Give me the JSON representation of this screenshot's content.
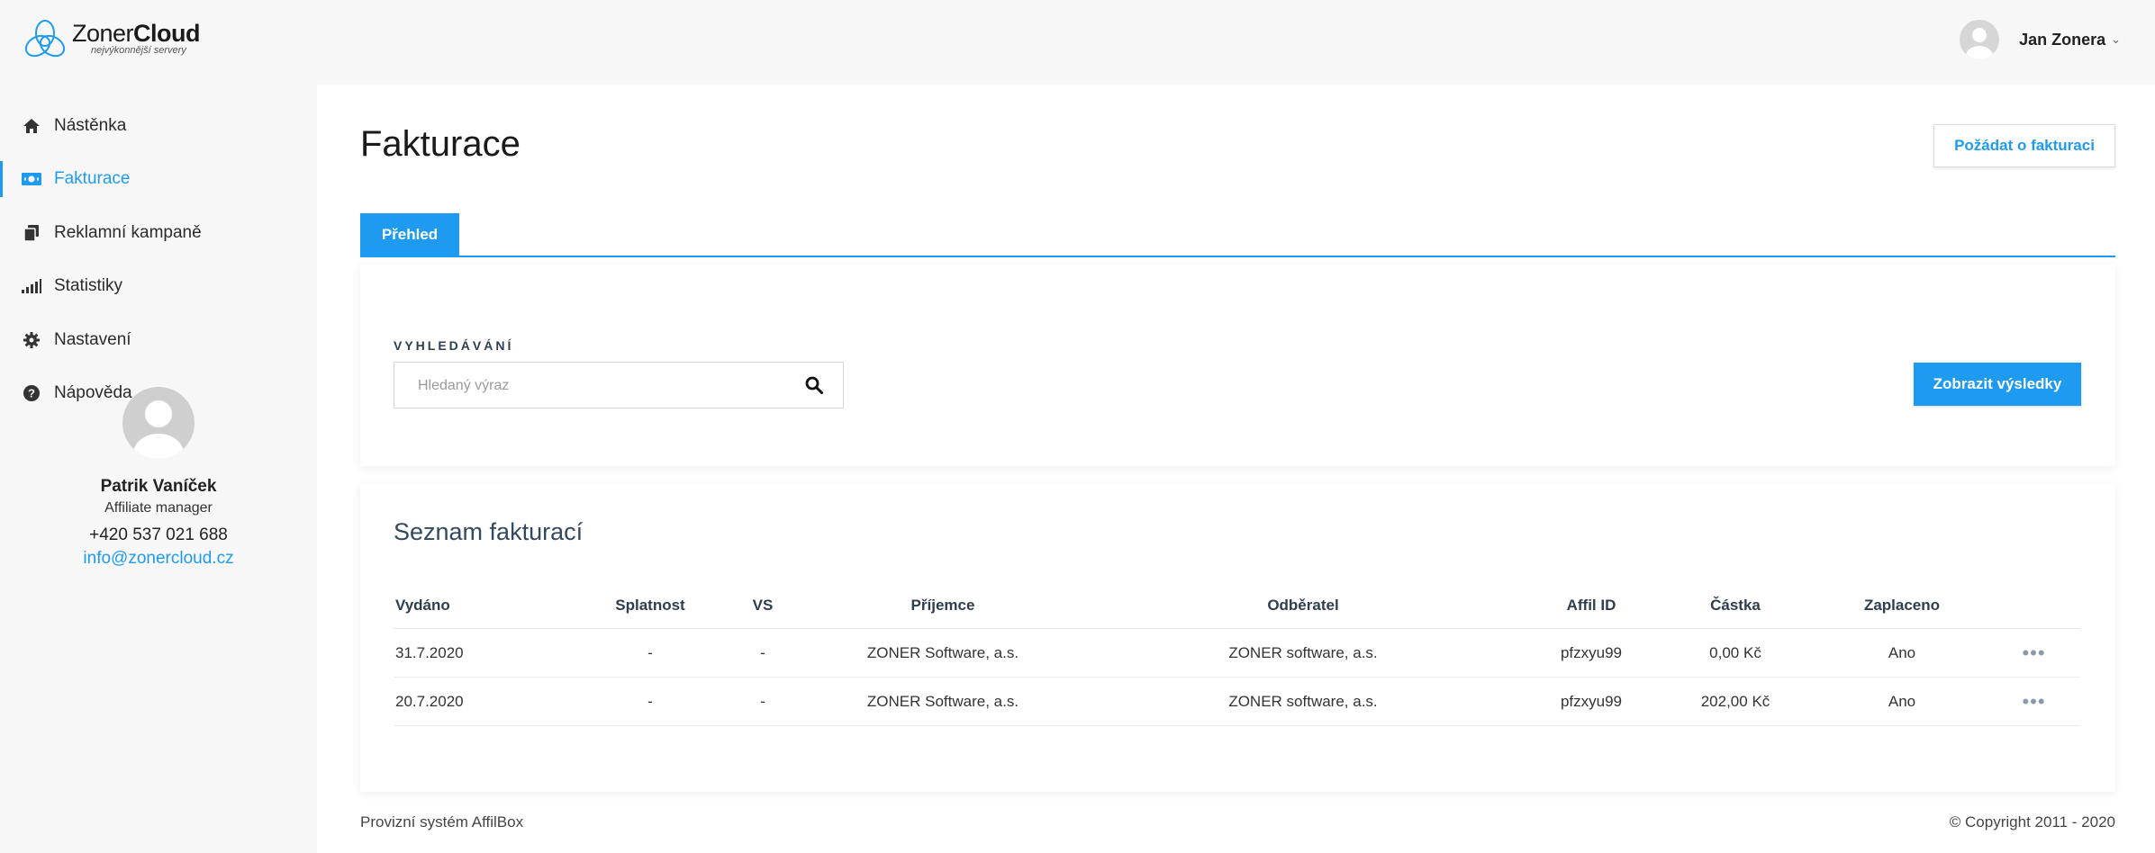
{
  "brand": {
    "name_regular": "Zoner",
    "name_bold": "Cloud",
    "tagline": "nejvýkonnější servery",
    "accent": "#1e9bf0"
  },
  "header": {
    "user_name": "Jan Zonera",
    "caret_icon": "chevron-down-icon"
  },
  "sidebar": {
    "items": [
      {
        "label": "Nástěnka",
        "icon": "home-icon",
        "active": false
      },
      {
        "label": "Fakturace",
        "icon": "money-icon",
        "active": true
      },
      {
        "label": "Reklamní kampaně",
        "icon": "copy-icon",
        "active": false
      },
      {
        "label": "Statistiky",
        "icon": "signal-icon",
        "active": false
      },
      {
        "label": "Nastavení",
        "icon": "gear-icon",
        "active": false
      },
      {
        "label": "Nápověda",
        "icon": "help-icon",
        "active": false
      }
    ],
    "manager": {
      "name": "Patrik Vaníček",
      "role": "Affiliate manager",
      "phone": "+420 537 021 688",
      "email": "info@zonercloud.cz"
    }
  },
  "main": {
    "title": "Fakturace",
    "request_button": "Požádat o fakturaci",
    "tabs": [
      {
        "label": "Přehled",
        "active": true
      }
    ],
    "search": {
      "label": "VYHLEDÁVÁNÍ",
      "placeholder": "Hledaný výraz",
      "value": "",
      "submit_label": "Zobrazit výsledky"
    },
    "list": {
      "title": "Seznam fakturací",
      "columns": [
        "Vydáno",
        "Splatnost",
        "VS",
        "Příjemce",
        "Odběratel",
        "Affil ID",
        "Částka",
        "Zaplaceno",
        ""
      ],
      "rows": [
        {
          "vydano": "31.7.2020",
          "splatnost": "-",
          "vs": "-",
          "prijemce": "ZONER Software, a.s.",
          "odberatel": "ZONER software, a.s.",
          "affil_id": "pfzxyu99",
          "castka": "0,00 Kč",
          "zaplaceno": "Ano",
          "more": "•••"
        },
        {
          "vydano": "20.7.2020",
          "splatnost": "-",
          "vs": "-",
          "prijemce": "ZONER Software, a.s.",
          "odberatel": "ZONER software, a.s.",
          "affil_id": "pfzxyu99",
          "castka": "202,00 Kč",
          "zaplaceno": "Ano",
          "more": "•••"
        }
      ]
    }
  },
  "footer": {
    "left": "Provizní systém AffilBox",
    "right": "© Copyright 2011 - 2020"
  }
}
